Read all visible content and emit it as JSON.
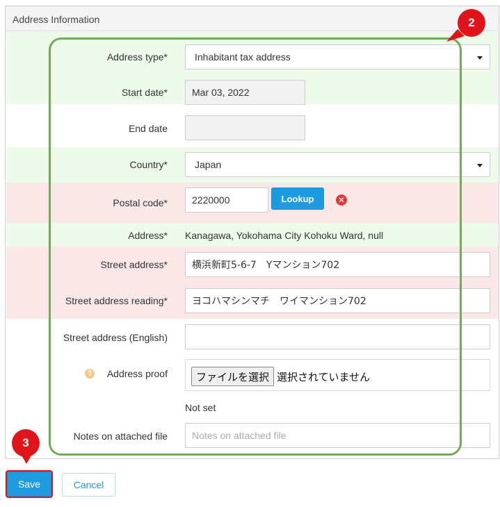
{
  "panel": {
    "title": "Address Information"
  },
  "form": {
    "address_type": {
      "label": "Address type*",
      "value": "Inhabitant tax address"
    },
    "start_date": {
      "label": "Start date*",
      "value": "Mar 03, 2022"
    },
    "end_date": {
      "label": "End date",
      "value": ""
    },
    "country": {
      "label": "Country*",
      "value": "Japan"
    },
    "postal_code": {
      "label": "Postal code*",
      "value": "2220000",
      "lookup_label": "Lookup"
    },
    "address": {
      "label": "Address*",
      "value": "Kanagawa, Yokohama City Kohoku Ward, null"
    },
    "street_address": {
      "label": "Street address*",
      "value": "横浜新町5-6-7　Yマンション702"
    },
    "street_address_reading": {
      "label": "Street address reading*",
      "value": "ヨコハマシンマチ　ワイマンション702"
    },
    "street_address_english": {
      "label": "Street address (English)",
      "value": ""
    },
    "address_proof": {
      "label": "Address proof",
      "file_button": "ファイルを選択",
      "file_status": "選択されていません",
      "current": "Not set"
    },
    "notes_attached": {
      "label": "Notes on attached file",
      "placeholder": "Notes on attached file"
    }
  },
  "footer": {
    "save_label": "Save",
    "cancel_label": "Cancel"
  },
  "annotations": {
    "badge_2": "2",
    "badge_3": "3"
  },
  "colors": {
    "primary": "#1f9be0",
    "required_bg": "#fae8e8",
    "valid_bg": "#eefbea",
    "annotation_red": "#e2141b",
    "frame_green": "#72ab55"
  }
}
